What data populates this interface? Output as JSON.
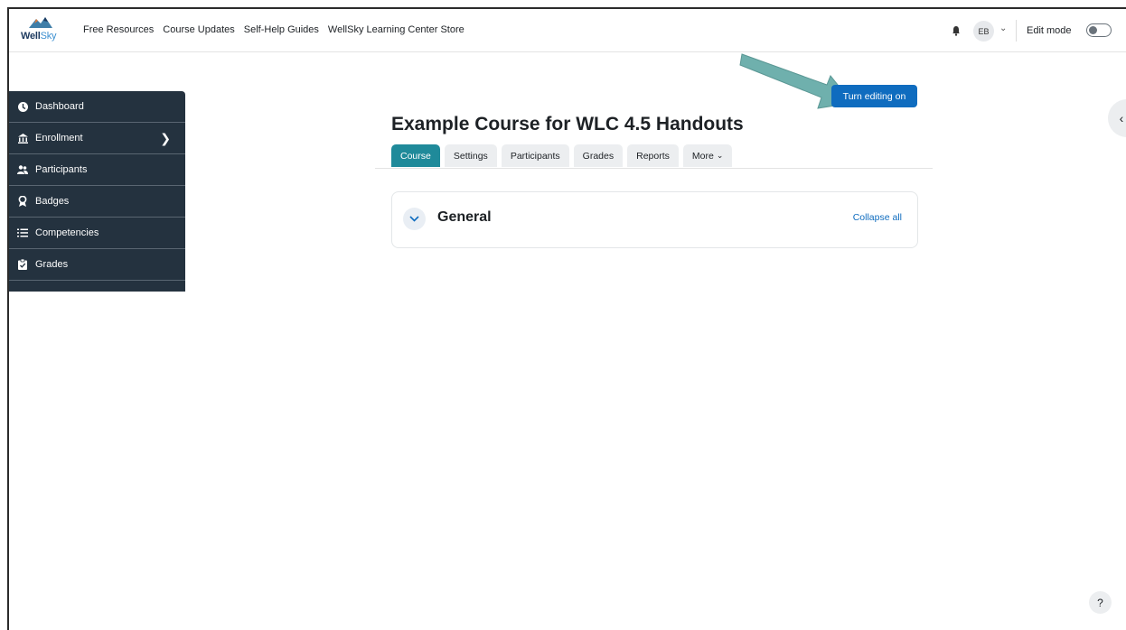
{
  "navbar": {
    "logo_text_bold": "Well",
    "logo_text_light": "Sky",
    "links": [
      "Free Resources",
      "Course Updates",
      "Self-Help Guides",
      "WellSky Learning Center Store"
    ],
    "user_initials": "EB",
    "edit_mode_label": "Edit mode"
  },
  "drawer": {
    "items": [
      {
        "label": "Dashboard",
        "icon": "dashboard-icon"
      },
      {
        "label": "Enrollment",
        "icon": "bank-icon",
        "has_chevron": true
      },
      {
        "label": "Participants",
        "icon": "users-icon"
      },
      {
        "label": "Badges",
        "icon": "badge-icon"
      },
      {
        "label": "Competencies",
        "icon": "list-icon"
      },
      {
        "label": "Grades",
        "icon": "clipboard-icon"
      }
    ]
  },
  "main": {
    "turn_editing_label": "Turn editing on",
    "page_title": "Example Course for WLC 4.5 Handouts",
    "tabs": [
      "Course",
      "Settings",
      "Participants",
      "Grades",
      "Reports",
      "More"
    ],
    "active_tab": "Course",
    "section_title": "General",
    "collapse_all_label": "Collapse all"
  },
  "help_label": "?",
  "colors": {
    "drawer_bg": "#24323f",
    "primary_button": "#0f6cbf",
    "active_tab": "#1f8a9a",
    "arrow": "#6fb0ad"
  }
}
